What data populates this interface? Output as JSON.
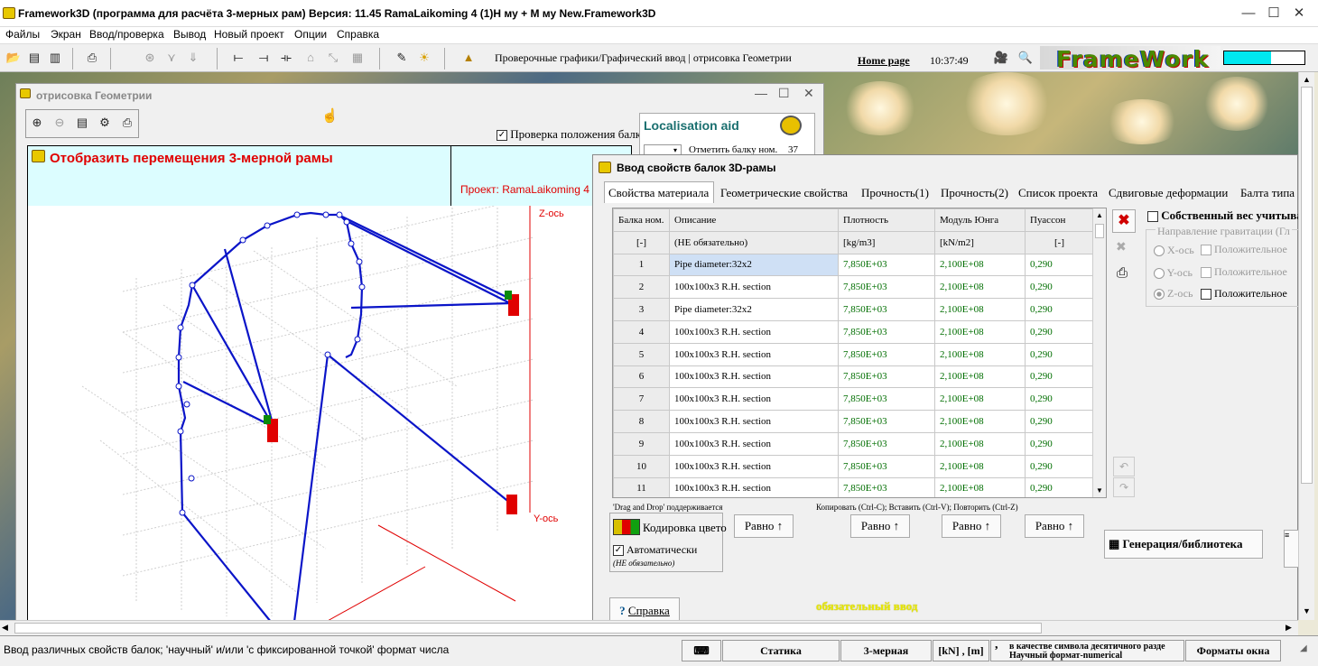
{
  "window": {
    "title": "Framework3D (программа для расчёта 3-мерных рам) Версия: 11.45  RamaLaikoming 4 (1)H му + M му New.Framework3D"
  },
  "menu": [
    "Файлы",
    "Экран",
    "Ввод/проверка",
    "Вывод",
    "Новый проект",
    "Опции",
    "Справка"
  ],
  "toolbar": {
    "status_text": "Проверочные графики/Графический ввод | отрисовка Геометрии",
    "home_link": "Home page",
    "time": "10:37:49",
    "logo": "FrameWork"
  },
  "geometry_window": {
    "title": "отрисовка Геометрии",
    "heading": "Отобразить перемещения 3-мерной рамы",
    "project_label": "Проект: RamaLaikoming 4",
    "check_label": "Проверка положения балки",
    "localisation_title": "Localisation aid",
    "mark_beam_label": "Отметить балку ном.",
    "mark_beam_value": "37",
    "axis_z": "Z-ось",
    "axis_y": "Y-ось"
  },
  "dialog": {
    "title": "Ввод свойств балок 3D-рамы",
    "tabs": [
      "Свойства материала",
      "Геометрические свойства",
      "Прочность(1)",
      "Прочность(2)",
      "Список проекта",
      "Сдвиговые деформации",
      "Балта типа"
    ],
    "table": {
      "headers": [
        "Балка ном.",
        "Описание",
        "Плотность",
        "Модуль Юнга",
        "Пуассон"
      ],
      "units": [
        "[-]",
        "(НЕ обязательно)",
        "[kg/m3]",
        "[kN/m2]",
        "[-]"
      ],
      "rows": [
        [
          "1",
          "Pipe diameter:32x2",
          "7,850E+03",
          "2,100E+08",
          "0,290"
        ],
        [
          "2",
          "100x100x3 R.H. section",
          "7,850E+03",
          "2,100E+08",
          "0,290"
        ],
        [
          "3",
          "Pipe diameter:32x2",
          "7,850E+03",
          "2,100E+08",
          "0,290"
        ],
        [
          "4",
          "100x100x3 R.H. section",
          "7,850E+03",
          "2,100E+08",
          "0,290"
        ],
        [
          "5",
          "100x100x3 R.H. section",
          "7,850E+03",
          "2,100E+08",
          "0,290"
        ],
        [
          "6",
          "100x100x3 R.H. section",
          "7,850E+03",
          "2,100E+08",
          "0,290"
        ],
        [
          "7",
          "100x100x3 R.H. section",
          "7,850E+03",
          "2,100E+08",
          "0,290"
        ],
        [
          "8",
          "100x100x3 R.H. section",
          "7,850E+03",
          "2,100E+08",
          "0,290"
        ],
        [
          "9",
          "100x100x3 R.H. section",
          "7,850E+03",
          "2,100E+08",
          "0,290"
        ],
        [
          "10",
          "100x100x3 R.H. section",
          "7,850E+03",
          "2,100E+08",
          "0,290"
        ],
        [
          "11",
          "100x100x3 R.H. section",
          "7,850E+03",
          "2,100E+08",
          "0,290"
        ]
      ]
    },
    "drag_drop_note": "'Drag and Drop' поддерживается",
    "copy_note": "Копировать (Ctrl-C); Вставить (Ctrl-V); Повторить (Ctrl-Z)",
    "equal_label": "Равно ↑",
    "color_coding_label": "Кодировка цвето",
    "auto_label": "Автоматически",
    "optional_label": "(НЕ обязательно)",
    "self_weight_label": "Собственный вес учитыва",
    "gravity_title": "Направление гравитации (Гл",
    "axes": [
      "X-ось",
      "Y-ось",
      "Z-ось"
    ],
    "positive_label": "Положительное",
    "generation_label": "Генерация/библиотека",
    "help_label": "Справка",
    "required_label": "обязательный ввод"
  },
  "statusbar": {
    "hint": "Ввод различных свойств балок; 'научный' и/или 'с фиксированной точкой' формат числа",
    "statics": "Статика",
    "dimension": "3-мерная",
    "units": "[kN] , [m]",
    "decimal_note_1": "в качестве символа десятичного разде",
    "decimal_note_2": "Научный формат-numerical",
    "window_formats": "Форматы окна"
  },
  "colors": {
    "heading_red": "#e00000",
    "frame_blue": "#0a14c8",
    "green_values": "#006e00",
    "header_cyan": "#dcfdff",
    "yellow_text": "#e8e800"
  }
}
